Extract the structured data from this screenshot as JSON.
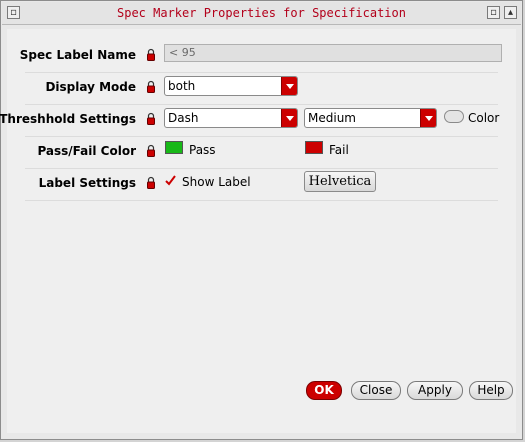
{
  "window": {
    "title": "Spec Marker Properties for Specification"
  },
  "rows": {
    "spec_label_name": {
      "label": "Spec Label Name",
      "value": "< 95"
    },
    "display_mode": {
      "label": "Display Mode",
      "value": "both"
    },
    "threshold_settings": {
      "label": "Threshhold Settings",
      "line_style": "Dash",
      "line_width": "Medium",
      "color_label": "Color"
    },
    "pass_fail_color": {
      "label": "Pass/Fail Color",
      "pass_label": "Pass",
      "pass_color": "#18b818",
      "fail_label": "Fail",
      "fail_color": "#cc0000"
    },
    "label_settings": {
      "label": "Label Settings",
      "show_label_text": "Show Label",
      "show_label_checked": true,
      "font_button": "Helvetica"
    }
  },
  "buttons": {
    "ok": "OK",
    "close": "Close",
    "apply": "Apply",
    "help": "Help"
  },
  "colors": {
    "accent": "#cc0000",
    "title_text": "#b3001b"
  }
}
